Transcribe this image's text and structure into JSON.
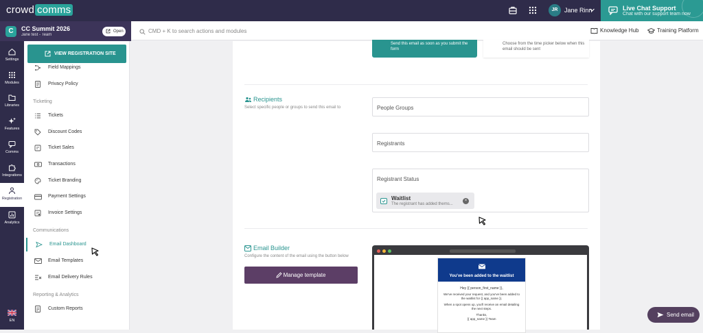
{
  "topbar": {
    "logo_left": "crowd",
    "logo_right": "comms",
    "user_initials": "JR",
    "user_name": "Jane Rinn",
    "live_title": "Live Chat Support",
    "live_subtitle": "Chat with our support team now"
  },
  "event": {
    "name": "CC Summit 2026",
    "sub": "Jane test - Team",
    "icon_letter": "C",
    "open_label": "Open"
  },
  "search": {
    "placeholder": "CMD + K to search actions and modules"
  },
  "links": {
    "knowledge": "Knowledge Hub",
    "training": "Training Platform"
  },
  "rail": [
    {
      "label": "Settings",
      "icon": "home-icon"
    },
    {
      "label": "Modules",
      "icon": "grid-icon"
    },
    {
      "label": "Libraries",
      "icon": "folder-icon"
    },
    {
      "label": "Features",
      "icon": "sparkle-icon"
    },
    {
      "label": "Comms",
      "icon": "chat-icon"
    },
    {
      "label": "Integrations",
      "icon": "puzzle-icon"
    },
    {
      "label": "Registration",
      "icon": "registration-icon"
    },
    {
      "label": "Analytics",
      "icon": "analytics-icon"
    }
  ],
  "rail_lang": "EN",
  "nav": {
    "view_reg": "VIEW REGISTRATION SITE",
    "items": [
      {
        "label": "Field Mappings",
        "icon": "field-mappings-icon"
      },
      {
        "label": "Privacy Policy",
        "icon": "document-icon"
      },
      {
        "label": "Tickets",
        "icon": "list-icon"
      },
      {
        "label": "Discount Codes",
        "icon": "tag-icon"
      },
      {
        "label": "Ticket Sales",
        "icon": "ticket-icon"
      },
      {
        "label": "Transactions",
        "icon": "cash-icon"
      },
      {
        "label": "Ticket Branding",
        "icon": "palette-icon"
      },
      {
        "label": "Payment Settings",
        "icon": "card-icon"
      },
      {
        "label": "Invoice Settings",
        "icon": "invoice-icon"
      },
      {
        "label": "Email Dashboard",
        "icon": "send-icon"
      },
      {
        "label": "Email Templates",
        "icon": "mail-icon"
      },
      {
        "label": "Email Delivery Rules",
        "icon": "rules-icon"
      },
      {
        "label": "Custom Reports",
        "icon": "report-icon"
      }
    ],
    "sections": [
      "Ticketing",
      "Communications",
      "Reporting & Analytics"
    ]
  },
  "schedule": {
    "option_now": "Send this email as soon as you submit the form",
    "option_later": "Choose from the time picker below when this email should be sent"
  },
  "recipients": {
    "title": "Recipients",
    "desc": "Select specific people or groups to send this email to",
    "people_groups": "People Groups",
    "registrants": "Registrants",
    "status_label": "Registrant Status",
    "chip_title": "Waitlist",
    "chip_desc": "The registrant has added thems..."
  },
  "builder": {
    "title": "Email Builder",
    "desc": "Configure the content of the email using the button below",
    "manage": "Manage template"
  },
  "email_preview": {
    "heading": "You've been added to the waitlist",
    "greeting": "Hey {{ person_first_name }},",
    "line1": "We've received your request, and you've been added to the waitlist for {{ app_name }}.",
    "line2": "When a spot opens up, you'll receive an email detailing the next steps.",
    "thanks": "Thanks,",
    "signoff": "{{ app_name }} Team"
  },
  "send_button": "Send email",
  "colors": {
    "teal": "#29948f",
    "navy": "#2f2c4a",
    "plum": "#5c3e66"
  }
}
